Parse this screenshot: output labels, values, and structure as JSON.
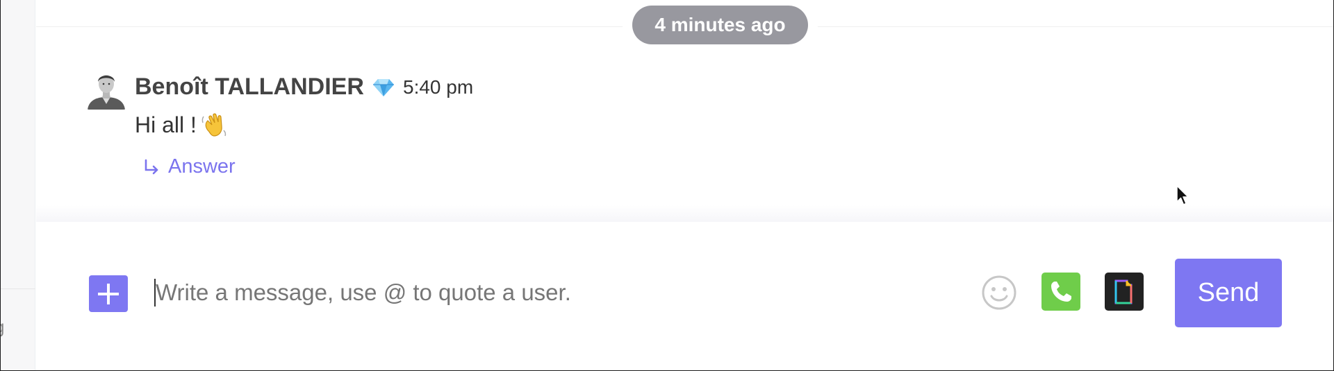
{
  "sidebar": {
    "clipped_text": "g"
  },
  "chat": {
    "date_separator": "4 minutes ago",
    "message": {
      "author": "Benoît TALLANDIER",
      "badge_icon": "diamond-icon",
      "time": "5:40 pm",
      "text": "Hi all !",
      "emoji_icon": "waving-hand-icon",
      "answer_label": "Answer"
    }
  },
  "composer": {
    "placeholder": "Write a message, use @ to quote a user.",
    "value": "",
    "send_label": "Send",
    "icons": [
      "plus-icon",
      "smiley-icon",
      "phone-icon",
      "gif-icon"
    ]
  },
  "colors": {
    "accent": "#7e77f2",
    "call_green": "#6fcd4a",
    "pill_gray": "#98989f",
    "gif_bg": "#222222"
  }
}
